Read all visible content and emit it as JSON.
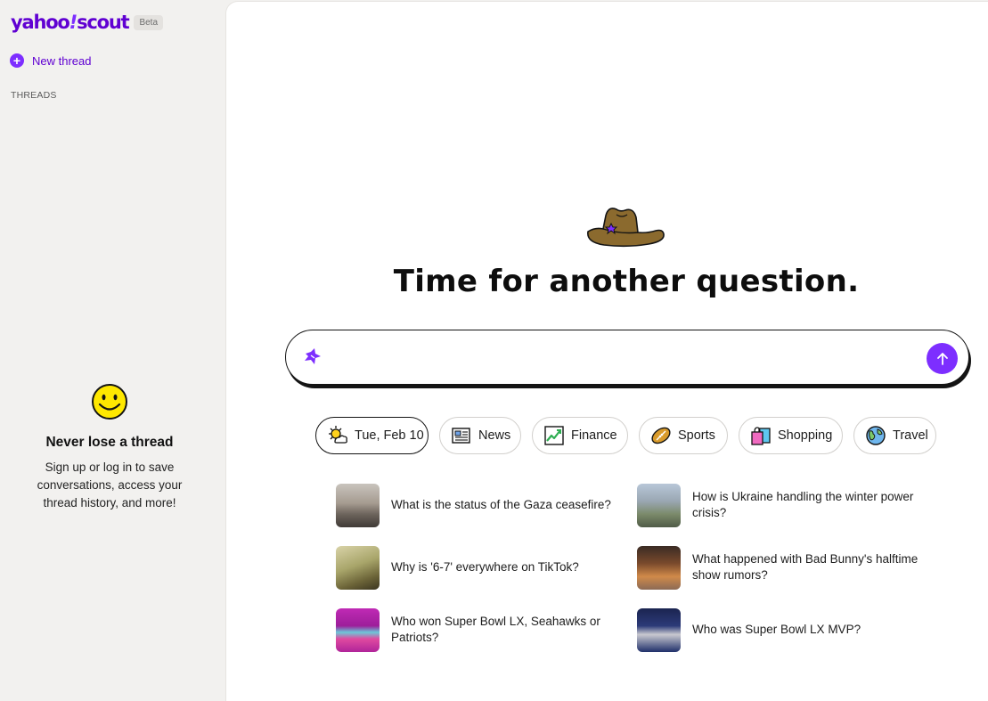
{
  "brand": {
    "logo_text": "yahoo",
    "logo_slash": "!",
    "logo_product": "scout",
    "badge": "Beta",
    "accent": "#7d2eff",
    "brand_color": "#6001d2"
  },
  "sidebar": {
    "new_thread_label": "New thread",
    "threads_heading": "THREADS",
    "promo": {
      "icon": "smiley-icon",
      "title": "Never lose a thread",
      "text": "Sign up or log in to save conversations, access your thread history, and more!"
    }
  },
  "main": {
    "headline": "Time for another question.",
    "search": {
      "placeholder": "",
      "value": "",
      "send_icon": "arrow-up-icon"
    },
    "chips": [
      {
        "label": "Tue, Feb 10",
        "icon": "sun-cloud-icon",
        "active": true
      },
      {
        "label": "News",
        "icon": "newspaper-icon"
      },
      {
        "label": "Finance",
        "icon": "chart-up-icon"
      },
      {
        "label": "Sports",
        "icon": "football-icon"
      },
      {
        "label": "Shopping",
        "icon": "shopping-bag-icon"
      },
      {
        "label": "Travel",
        "icon": "globe-icon"
      }
    ],
    "suggestions": [
      {
        "text": "What is the status of the Gaza ceasefire?"
      },
      {
        "text": "How is Ukraine handling the winter power crisis?"
      },
      {
        "text": "Why is '6-7' everywhere on TikTok?"
      },
      {
        "text": "What happened with Bad Bunny's halftime show rumors?"
      },
      {
        "text": "Who won Super Bowl LX, Seahawks or Patriots?"
      },
      {
        "text": "Who was Super Bowl LX MVP?"
      }
    ]
  }
}
